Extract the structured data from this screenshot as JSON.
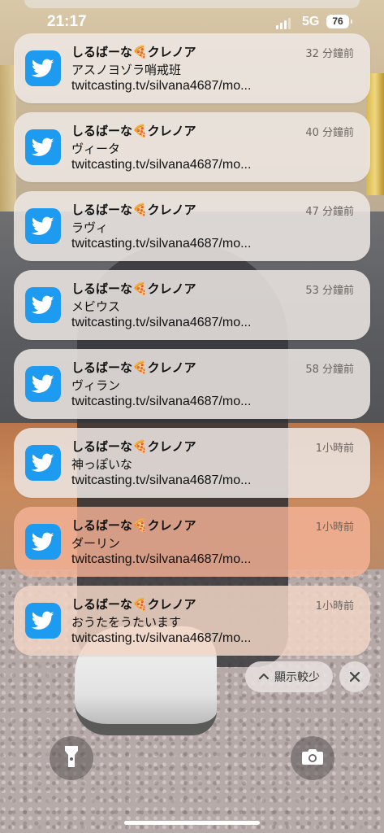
{
  "status_bar": {
    "time": "21:17",
    "network": "5G",
    "battery": "76"
  },
  "notifications": [
    {
      "app_icon": "twitter-bird-icon",
      "sender": "しるばーな🍕クレノア",
      "time": "32 分鐘前",
      "title": "アスノヨゾラ哨戒班",
      "body": "twitcasting.tv/silvana4687/mo...",
      "tint": "neutral"
    },
    {
      "app_icon": "twitter-bird-icon",
      "sender": "しるばーな🍕クレノア",
      "time": "40 分鐘前",
      "title": "ヴィータ",
      "body": "twitcasting.tv/silvana4687/mo...",
      "tint": "neutral"
    },
    {
      "app_icon": "twitter-bird-icon",
      "sender": "しるばーな🍕クレノア",
      "time": "47 分鐘前",
      "title": "ラヴィ",
      "body": "twitcasting.tv/silvana4687/mo...",
      "tint": "neutral"
    },
    {
      "app_icon": "twitter-bird-icon",
      "sender": "しるばーな🍕クレノア",
      "time": "53 分鐘前",
      "title": "メビウス",
      "body": "twitcasting.tv/silvana4687/mo...",
      "tint": "neutral"
    },
    {
      "app_icon": "twitter-bird-icon",
      "sender": "しるばーな🍕クレノア",
      "time": "58 分鐘前",
      "title": "ヴィラン",
      "body": "twitcasting.tv/silvana4687/mo...",
      "tint": "neutral"
    },
    {
      "app_icon": "twitter-bird-icon",
      "sender": "しるばーな🍕クレノア",
      "time": "1小時前",
      "title": "神っぽいな",
      "body": "twitcasting.tv/silvana4687/mo...",
      "tint": "neutral"
    },
    {
      "app_icon": "twitter-bird-icon",
      "sender": "しるばーな🍕クレノア",
      "time": "1小時前",
      "title": "ダーリン",
      "body": "twitcasting.tv/silvana4687/mo...",
      "tint": "warm"
    },
    {
      "app_icon": "twitter-bird-icon",
      "sender": "しるばーな🍕クレノア",
      "time": "1小時前",
      "title": "おうたをうたいます",
      "body": "twitcasting.tv/silvana4687/mo...",
      "tint": "peach"
    }
  ],
  "controls": {
    "show_less_label": "顯示較少",
    "show_less_icon": "chevron-up-icon",
    "close_icon": "close-icon",
    "flashlight_icon": "flashlight-icon",
    "camera_icon": "camera-icon"
  },
  "colors": {
    "twitter_blue": "#1d9bf0"
  }
}
